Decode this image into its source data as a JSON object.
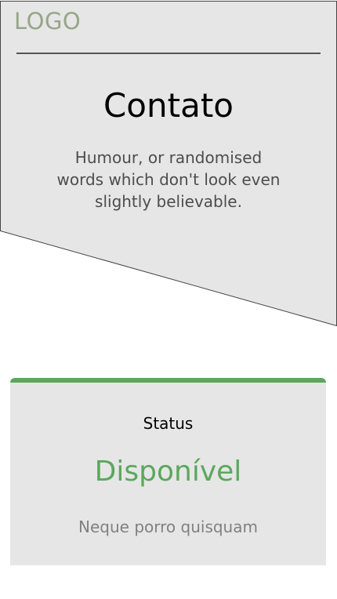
{
  "header": {
    "logo": "LOGO",
    "title": "Contato",
    "description": "Humour, or randomised words which don't look even slightly believable."
  },
  "status_card": {
    "label": "Status",
    "value": "Disponível",
    "description": "Neque porro quisquam"
  },
  "colors": {
    "hero_background": "#e6e6e6",
    "logo": "#97a589",
    "accent": "#5aa85c",
    "muted_text": "#808080"
  }
}
